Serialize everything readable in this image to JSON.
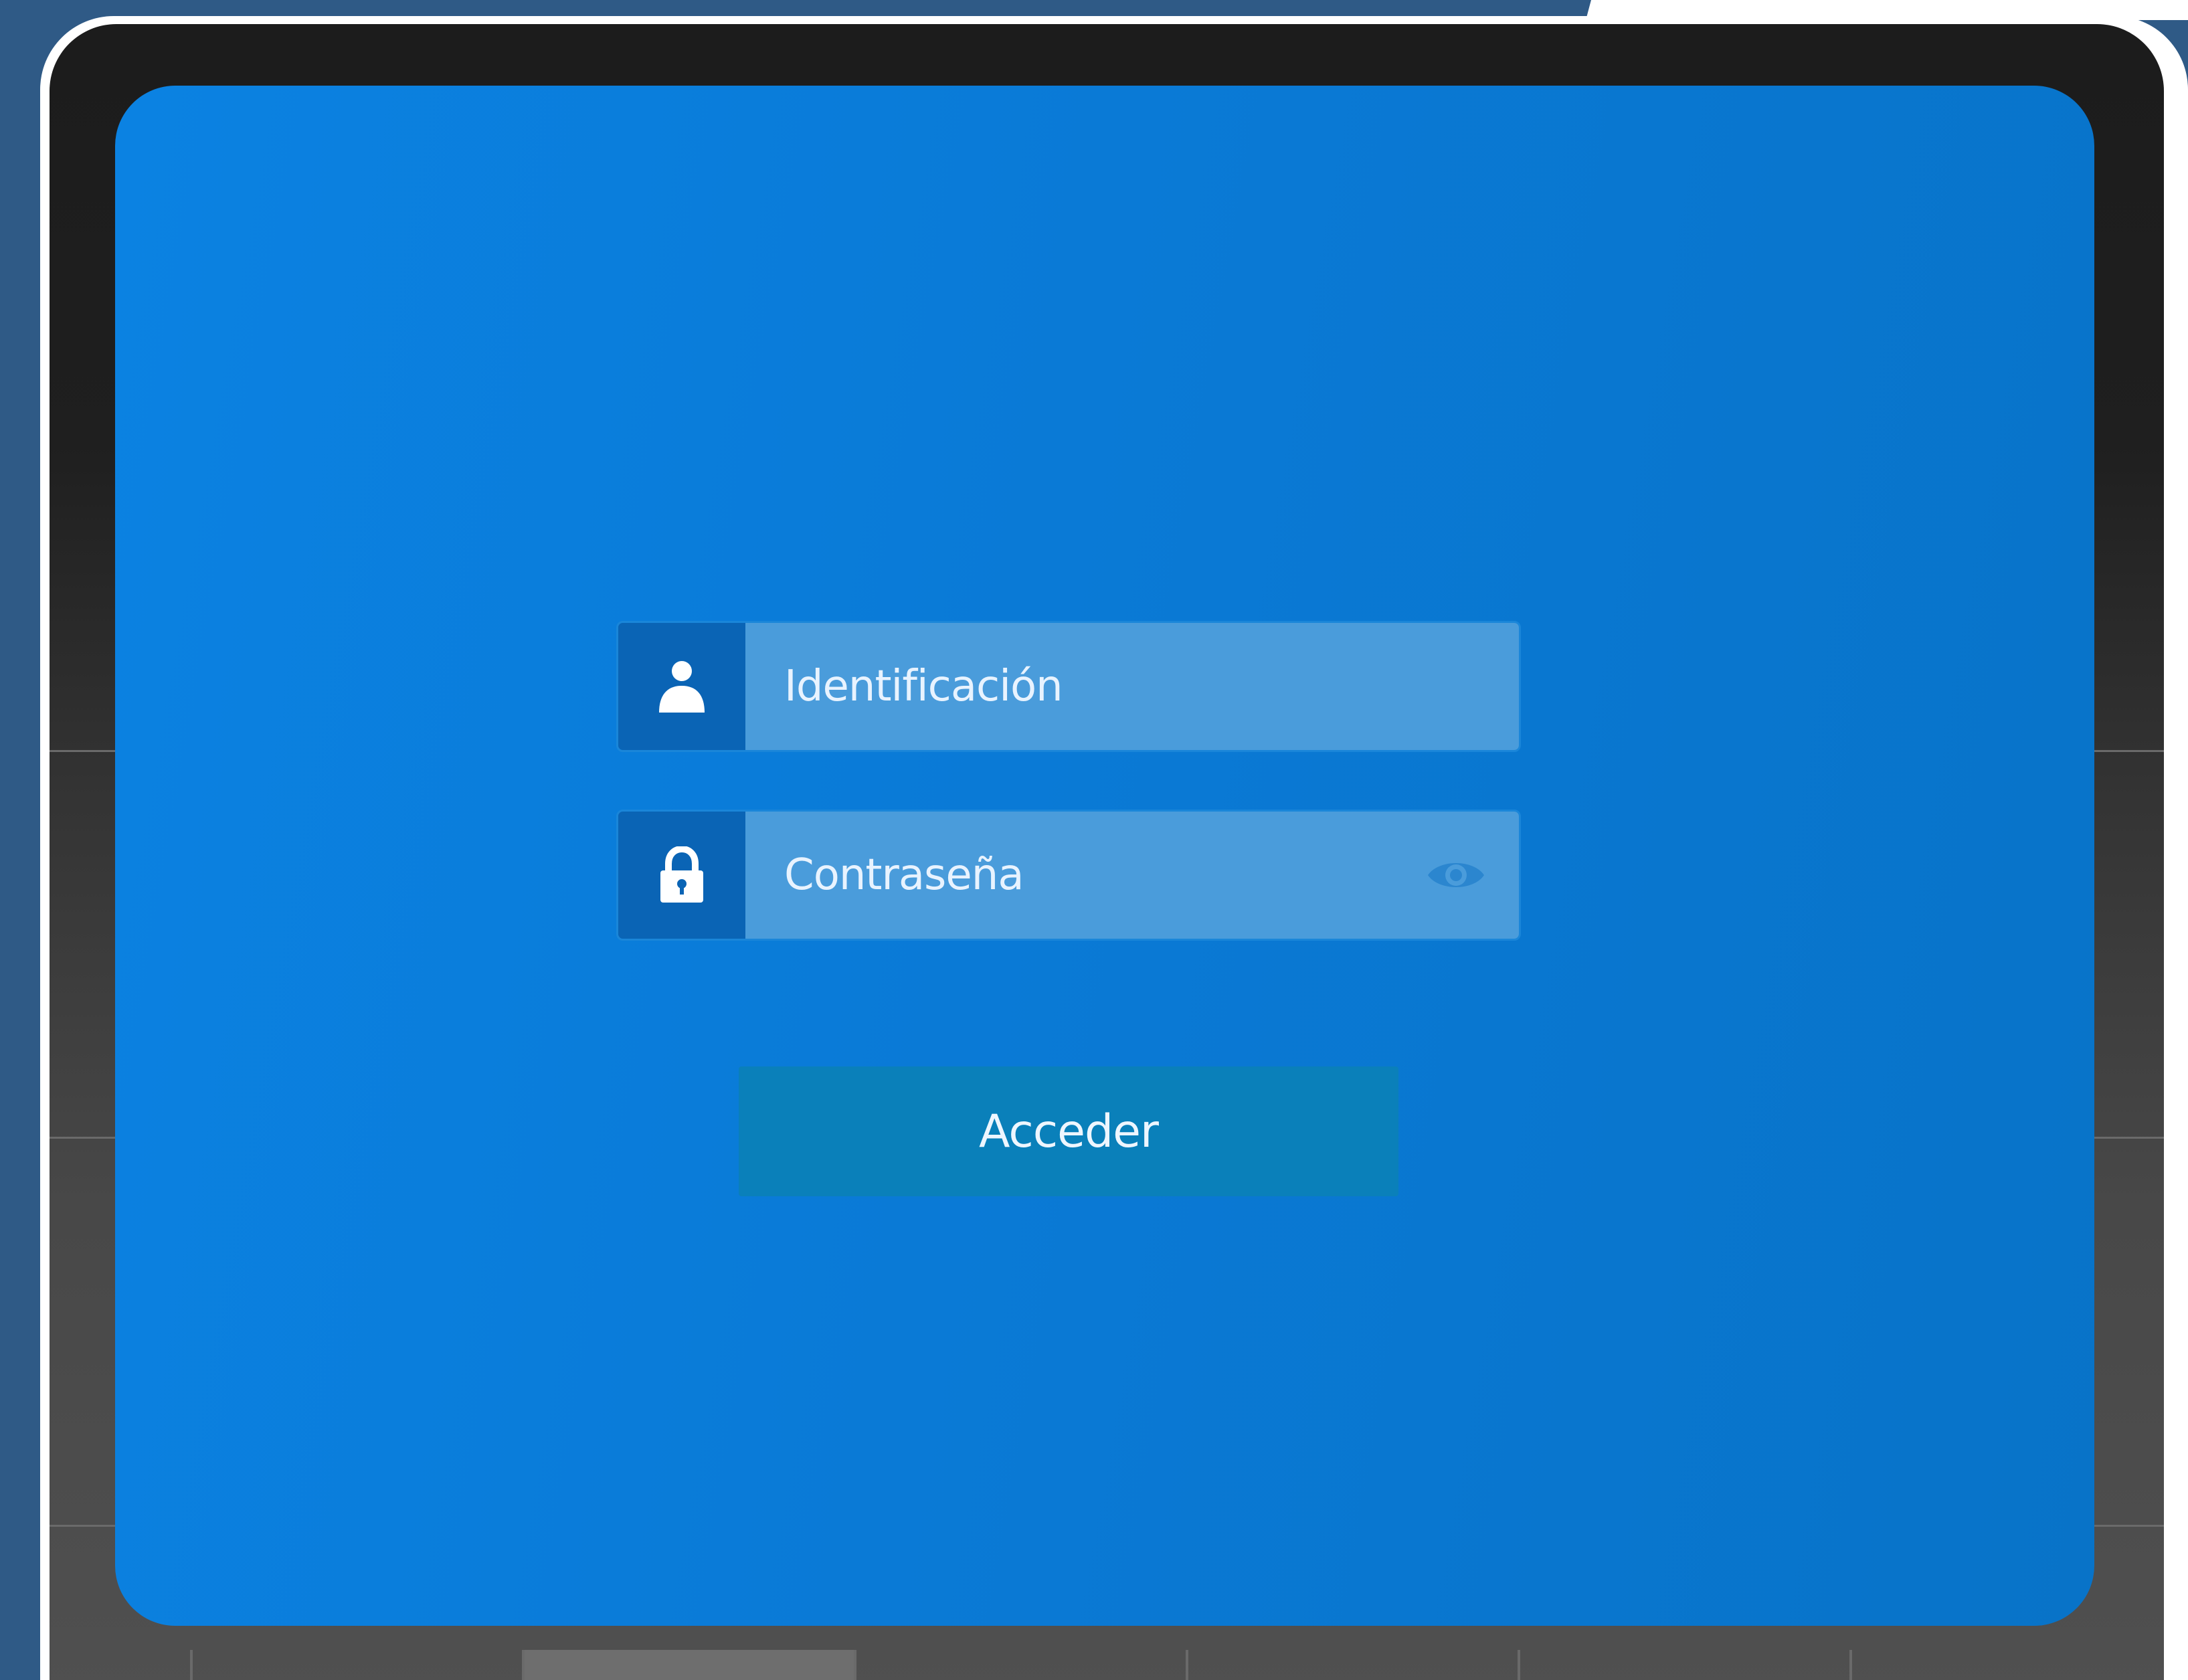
{
  "login": {
    "username_placeholder": "Identificación",
    "password_placeholder": "Contraseña",
    "submit_label": "Acceder"
  },
  "icons": {
    "username": "user-icon",
    "password": "lock-icon",
    "reveal": "eye-icon"
  },
  "colors": {
    "panel": "#0a7ad6",
    "input_fill": "#4a9cdb",
    "addon": "#0a64b5",
    "button": "#0a80ba"
  }
}
